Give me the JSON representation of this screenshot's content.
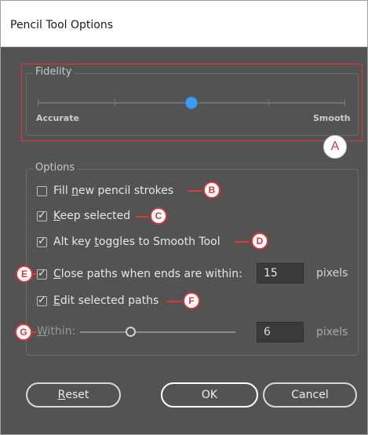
{
  "dialog": {
    "title": "Pencil Tool Options"
  },
  "fidelity": {
    "group_label": "Fidelity",
    "left_label": "Accurate",
    "right_label": "Smooth",
    "value_fraction": 0.5,
    "accent": "#3d9cf5"
  },
  "options": {
    "group_label": "Options",
    "fill_new": {
      "label_pre": "Fill ",
      "label_u": "n",
      "label_post": "ew pencil strokes",
      "checked": false
    },
    "keep_selected": {
      "label_pre": "",
      "label_u": "K",
      "label_post": "eep selected",
      "checked": true
    },
    "alt_key": {
      "label_pre": "Alt key ",
      "label_u": "t",
      "label_post": "oggles to Smooth Tool",
      "checked": true
    },
    "close_paths": {
      "label_pre": "",
      "label_u": "C",
      "label_post": "lose paths when ends are within:",
      "checked": true,
      "value": "15",
      "unit": "pixels"
    },
    "edit_selected": {
      "label_pre": "",
      "label_u": "E",
      "label_post": "dit selected paths",
      "checked": true
    },
    "within": {
      "label_pre": "",
      "label_u": "W",
      "label_post": "ithin:",
      "value": "6",
      "unit": "pixels",
      "value_fraction": 0.33
    }
  },
  "buttons": {
    "reset": {
      "label_u": "R",
      "label_post": "eset"
    },
    "ok": "OK",
    "cancel": "Cancel"
  },
  "callouts": {
    "a": "A",
    "b": "B",
    "c": "C",
    "d": "D",
    "e": "E",
    "f": "F",
    "g": "G"
  },
  "colors": {
    "callout_red": "#e5373a",
    "dialog_bg": "#535353"
  }
}
